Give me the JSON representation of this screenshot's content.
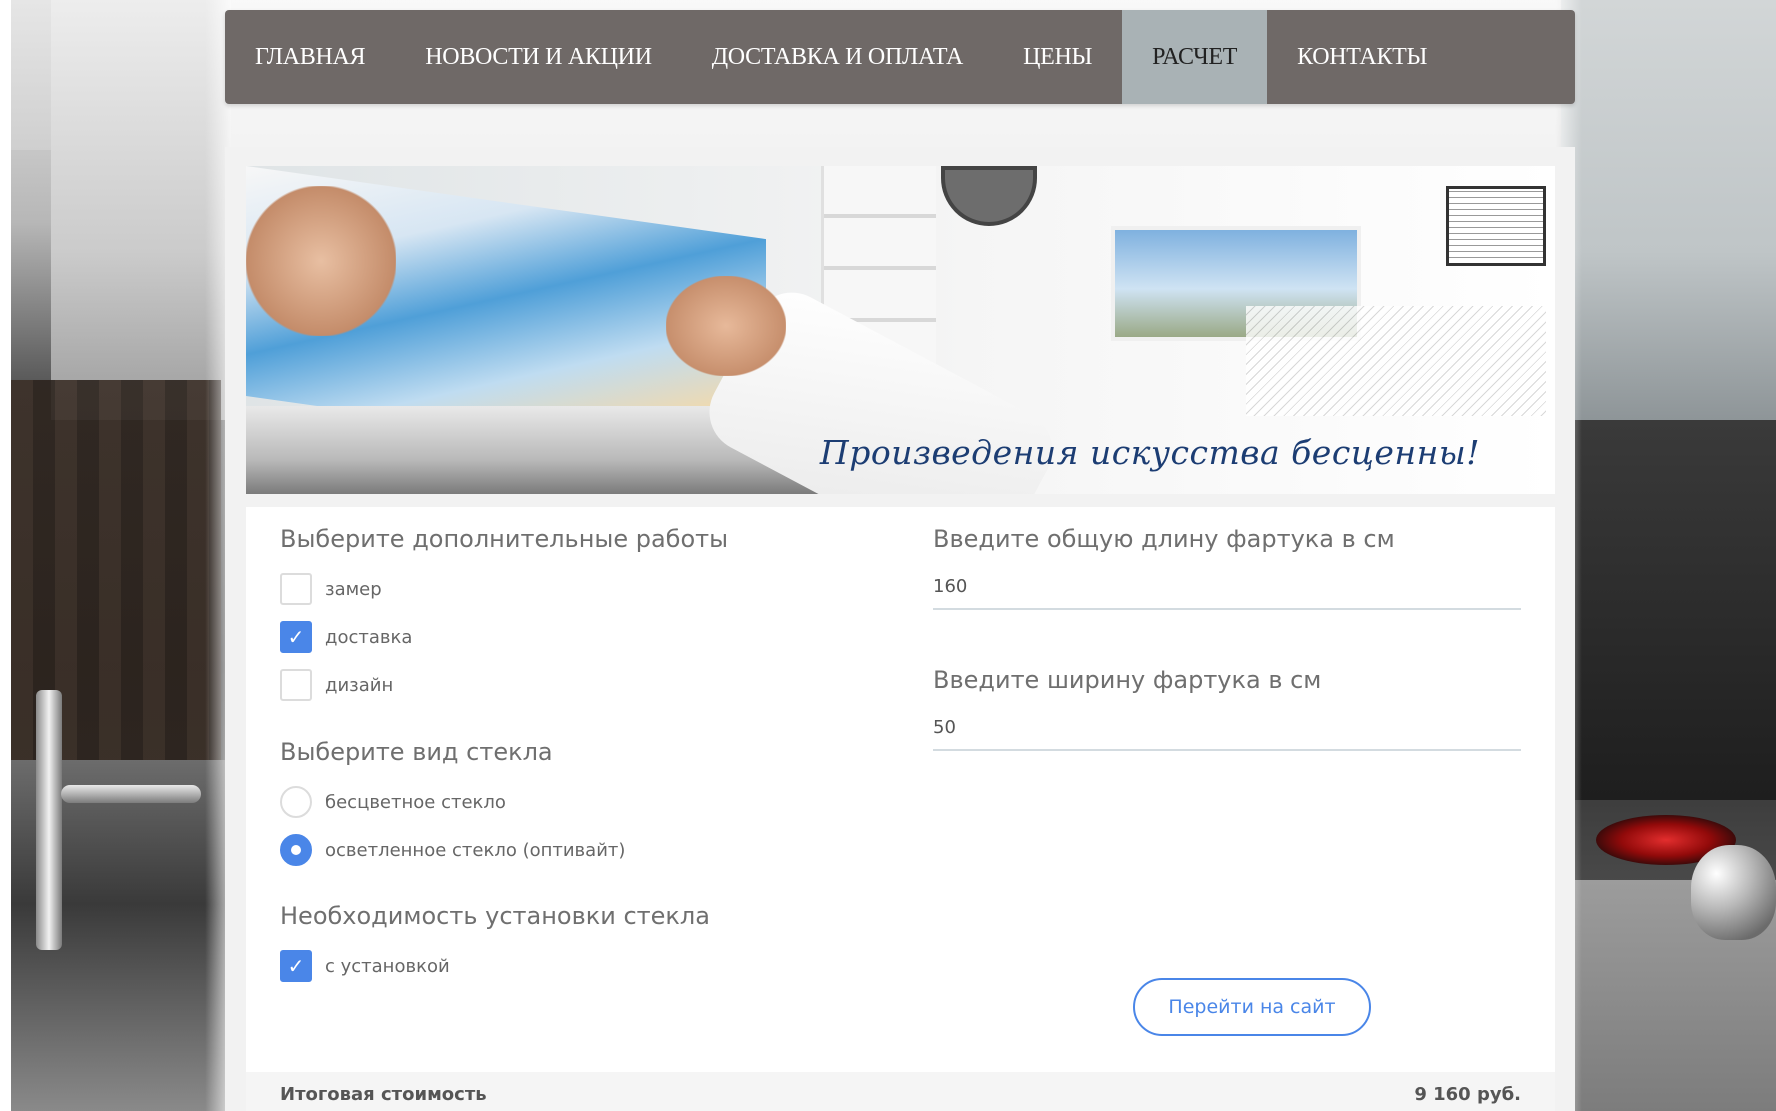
{
  "nav": {
    "items": [
      {
        "label": "ГЛАВНАЯ",
        "active": false
      },
      {
        "label": "НОВОСТИ И АКЦИИ",
        "active": false
      },
      {
        "label": "ДОСТАВКА И ОПЛАТА",
        "active": false
      },
      {
        "label": "ЦЕНЫ",
        "active": false
      },
      {
        "label": "РАСЧЕТ",
        "active": true
      },
      {
        "label": "КОНТАКТЫ",
        "active": false
      }
    ]
  },
  "banner": {
    "slogan": "Произведения искусства бесценны!"
  },
  "extras": {
    "title": "Выберите дополнительные работы",
    "options": [
      {
        "label": "замер",
        "checked": false
      },
      {
        "label": "доставка",
        "checked": true
      },
      {
        "label": "дизайн",
        "checked": false
      }
    ]
  },
  "glass": {
    "title": "Выберите вид стекла",
    "options": [
      {
        "label": "бесцветное стекло",
        "selected": false
      },
      {
        "label": "осветленное стекло (оптивайт)",
        "selected": true
      }
    ]
  },
  "install": {
    "title": "Необходимость установки стекла",
    "option": {
      "label": "с установкой",
      "checked": true
    }
  },
  "length": {
    "title": "Введите общую длину фартука в см",
    "value": "160"
  },
  "width": {
    "title": "Введите ширину фартука в см",
    "value": "50"
  },
  "site_button": {
    "label": "Перейти на сайт"
  },
  "total": {
    "label": "Итоговая стоимость",
    "value": "9 160 руб."
  },
  "colors": {
    "nav_bg": "#6f6967",
    "nav_active": "#a9b2b5",
    "accent": "#4a86e8",
    "slogan": "#1c3d73"
  },
  "icons": {
    "checkbox_checked": "check-icon",
    "radio_selected": "radio-dot-icon"
  }
}
